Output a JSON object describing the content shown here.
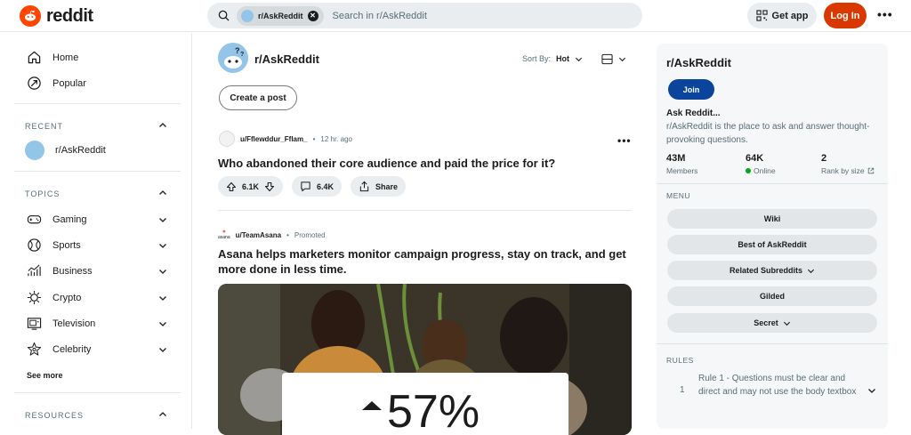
{
  "header": {
    "logo_text": "reddit",
    "search_chip": "r/AskReddit",
    "search_placeholder": "Search in r/AskReddit",
    "get_app": "Get app",
    "login": "Log In"
  },
  "leftnav": {
    "home": "Home",
    "popular": "Popular",
    "recent_label": "RECENT",
    "recent_item": "r/AskReddit",
    "topics_label": "TOPICS",
    "topics": [
      "Gaming",
      "Sports",
      "Business",
      "Crypto",
      "Television",
      "Celebrity"
    ],
    "see_more": "See more",
    "resources_label": "RESOURCES"
  },
  "main": {
    "subreddit": "r/AskReddit",
    "sort_label": "Sort By:",
    "sort_value": "Hot",
    "create_post": "Create a post",
    "post1": {
      "author": "u/Fflewddur_Fflam_",
      "time": "12 hr. ago",
      "title": "Who abandoned their core audience and paid the price for it?",
      "votes": "6.1K",
      "comments": "6.4K",
      "share": "Share"
    },
    "promo": {
      "brand": "asana",
      "author": "u/TeamAsana",
      "promoted": "Promoted",
      "title": "Asana helps marketers monitor campaign progress, stay on track, and get more done in less time.",
      "stat": "57%"
    }
  },
  "sidebar": {
    "title": "r/AskReddit",
    "join": "Join",
    "name": "Ask Reddit...",
    "description": "r/AskReddit is the place to ask and answer thought-provoking questions.",
    "members_value": "43M",
    "members_label": "Members",
    "online_value": "64K",
    "online_label": "Online",
    "rank_value": "2",
    "rank_label": "Rank by size",
    "menu_label": "MENU",
    "menu": [
      "Wiki",
      "Best of AskReddit",
      "Related Subreddits",
      "Gilded",
      "Secret"
    ],
    "rules_label": "RULES",
    "rule1_num": "1",
    "rule1_text": "Rule 1 - Questions must be clear and direct and may not use the body textbox"
  },
  "colors": {
    "brand": "#ff4500",
    "login_bg": "#d93900",
    "join_bg": "#0a449b",
    "online": "#01a816"
  }
}
